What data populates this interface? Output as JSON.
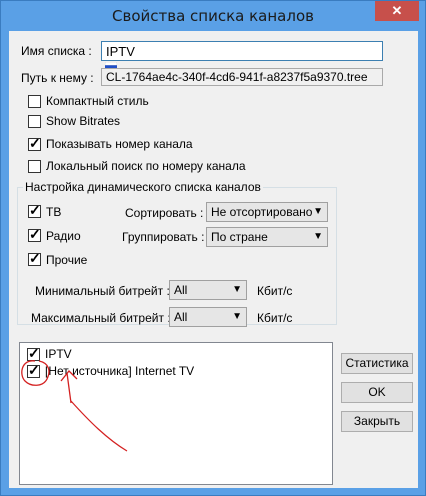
{
  "window": {
    "title": "Свойства списка каналов",
    "close_glyph": "✕"
  },
  "list_name": {
    "label": "Имя списка :",
    "value": "IPTV"
  },
  "path": {
    "label": "Путь к нему :",
    "value": "CL-1764ae4c-340f-4cd6-941f-a8237f5a9370.tree"
  },
  "options": [
    {
      "label": "Компактный стиль",
      "checked": false
    },
    {
      "label": "Show Bitrates",
      "checked": false
    },
    {
      "label": "Показывать номер канала",
      "checked": true
    },
    {
      "label": "Локальный поиск по номеру канала",
      "checked": false
    }
  ],
  "dynamic": {
    "title": "Настройка динамического списка каналов",
    "tv": {
      "label": "ТВ",
      "checked": true
    },
    "radio": {
      "label": "Радио",
      "checked": true
    },
    "other": {
      "label": "Прочие",
      "checked": true
    },
    "sort": {
      "label": "Сортировать :",
      "value": "Не отсортировано"
    },
    "group": {
      "label": "Группировать :",
      "value": "По стране"
    },
    "min_bitrate": {
      "label": "Минимальный битрейт :",
      "value": "All",
      "unit": "Кбит/с"
    },
    "max_bitrate": {
      "label": "Максимальный битрейт :",
      "value": "All",
      "unit": "Кбит/с"
    }
  },
  "sources": [
    {
      "label": "IPTV",
      "checked": true
    },
    {
      "label": "[Нет источника] Internet TV",
      "checked": true
    }
  ],
  "buttons": {
    "stats": "Статистика",
    "ok": "OK",
    "close": "Закрыть"
  },
  "colors": {
    "annotation": "#d42020",
    "accent": "#3c7fb1"
  }
}
